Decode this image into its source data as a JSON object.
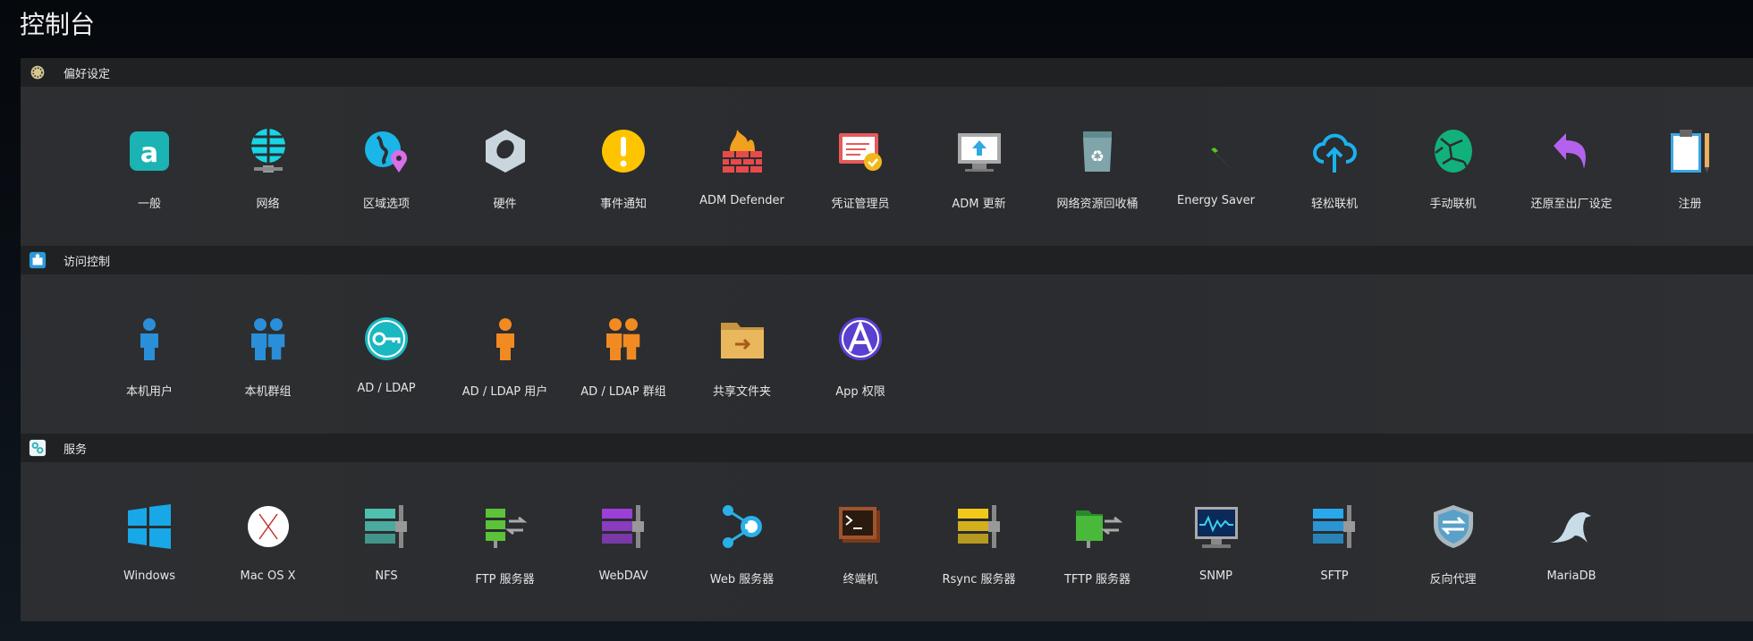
{
  "title": "控制台",
  "sections": [
    {
      "name": "偏好设定",
      "icon": "gear-icon",
      "items": [
        {
          "label": "一般",
          "icon": "general-icon",
          "color": "#1bb3b3"
        },
        {
          "label": "网络",
          "icon": "globe-network-icon",
          "color": "#18d6e6"
        },
        {
          "label": "区域选项",
          "icon": "globe-pin-icon",
          "color": "#1ab6e8"
        },
        {
          "label": "硬件",
          "icon": "nut-icon",
          "color": "#c9d6dd"
        },
        {
          "label": "事件通知",
          "icon": "alert-icon",
          "color": "#ffc400"
        },
        {
          "label": "ADM Defender",
          "icon": "firewall-icon",
          "color": "#e84a4a"
        },
        {
          "label": "凭证管理员",
          "icon": "certificate-icon",
          "color": "#e85a5a"
        },
        {
          "label": "ADM 更新",
          "icon": "monitor-update-icon",
          "color": "#2fa9e0"
        },
        {
          "label": "网络资源回收桶",
          "icon": "recycle-bin-icon",
          "color": "#7fa4aa"
        },
        {
          "label": "Energy Saver",
          "icon": "lightning-icon",
          "color": "#5cc21a"
        },
        {
          "label": "轻松联机",
          "icon": "cloud-upload-icon",
          "color": "#19b2ee"
        },
        {
          "label": "手动联机",
          "icon": "network-ball-icon",
          "color": "#12b07a"
        },
        {
          "label": "还原至出厂设定",
          "icon": "undo-icon",
          "color": "#b462ee"
        },
        {
          "label": "注册",
          "icon": "clipboard-icon",
          "color": "#3aa6e8"
        }
      ]
    },
    {
      "name": "访问控制",
      "icon": "access-control-icon",
      "items": [
        {
          "label": "本机用户",
          "icon": "user-icon",
          "color": "#2a8fd8"
        },
        {
          "label": "本机群组",
          "icon": "group-icon",
          "color": "#2a8fd8"
        },
        {
          "label": "AD / LDAP",
          "icon": "key-icon",
          "color": "#1ab8c0"
        },
        {
          "label": "AD / LDAP 用户",
          "icon": "user-icon",
          "color": "#f28a22"
        },
        {
          "label": "AD / LDAP 群组",
          "icon": "group-icon",
          "color": "#f28a22"
        },
        {
          "label": "共享文件夹",
          "icon": "folder-icon",
          "color": "#e9b75c"
        },
        {
          "label": "App 权限",
          "icon": "app-permission-icon",
          "color": "#5a3fd0"
        }
      ]
    },
    {
      "name": "服务",
      "icon": "services-icon",
      "items": [
        {
          "label": "Windows",
          "icon": "windows-icon",
          "color": "#18a8e8"
        },
        {
          "label": "Mac OS X",
          "icon": "mac-icon",
          "color": "#ffffff"
        },
        {
          "label": "NFS",
          "icon": "server-icon",
          "color": "#4fc1b0"
        },
        {
          "label": "FTP 服务器",
          "icon": "server-transfer-icon",
          "color": "#5cc23a"
        },
        {
          "label": "WebDAV",
          "icon": "server-icon",
          "color": "#9b3fd8"
        },
        {
          "label": "Web 服务器",
          "icon": "share-nodes-icon",
          "color": "#2ab0e8"
        },
        {
          "label": "终端机",
          "icon": "terminal-icon",
          "color": "#a0542c"
        },
        {
          "label": "Rsync 服务器",
          "icon": "server-icon",
          "color": "#f2c81a"
        },
        {
          "label": "TFTP 服务器",
          "icon": "folder-transfer-icon",
          "color": "#4ab83a"
        },
        {
          "label": "SNMP",
          "icon": "monitor-graph-icon",
          "color": "#2a8ad8"
        },
        {
          "label": "SFTP",
          "icon": "server-icon",
          "color": "#2aa8ee"
        },
        {
          "label": "反向代理",
          "icon": "shield-arrows-icon",
          "color": "#5aa0c8"
        },
        {
          "label": "MariaDB",
          "icon": "seal-icon",
          "color": "#c8dce8"
        }
      ]
    }
  ]
}
